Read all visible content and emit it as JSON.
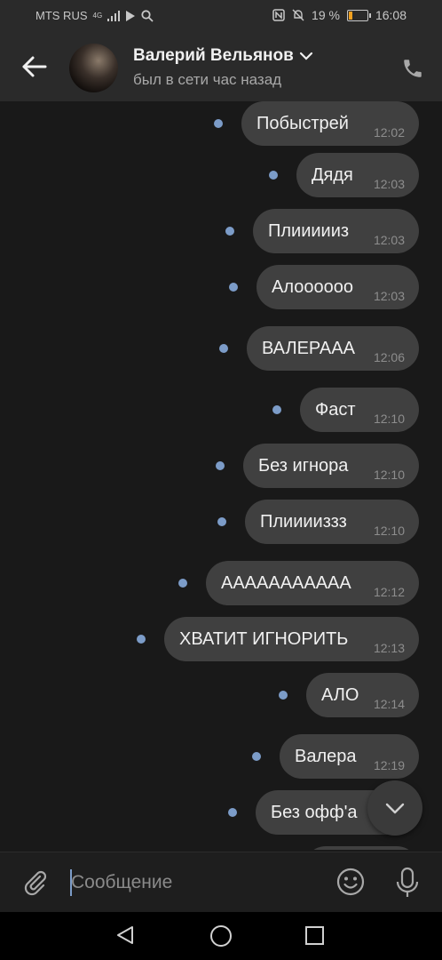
{
  "status_bar": {
    "carrier": "MTS RUS",
    "network": "4G",
    "battery": "19 %",
    "battery_level": 0.19,
    "time": "16:08"
  },
  "header": {
    "contact_name": "Валерий Вельянов",
    "contact_status": "был в сети час назад",
    "icons": [
      "back-arrow-icon",
      "chevron-down-icon",
      "phone-icon"
    ]
  },
  "messages": [
    {
      "text": "Побыстрей",
      "time": "12:02"
    },
    {
      "text": "Дядя",
      "time": "12:03"
    },
    {
      "text": "Плиииииз",
      "time": "12:03"
    },
    {
      "text": "Алоооооо",
      "time": "12:03"
    },
    {
      "text": "ВАЛЕРААА",
      "time": "12:06"
    },
    {
      "text": "Фаст",
      "time": "12:10"
    },
    {
      "text": "Без игнора",
      "time": "12:10"
    },
    {
      "text": "Плииииззз",
      "time": "12:10"
    },
    {
      "text": "ААААААААААА",
      "time": "12:12"
    },
    {
      "text": "ХВАТИТ ИГНОРИТЬ",
      "time": "12:13"
    },
    {
      "text": "АЛО",
      "time": "12:14"
    },
    {
      "text": "Валера",
      "time": "12:19"
    },
    {
      "text": "Без офф'а",
      "time": ""
    }
  ],
  "composer": {
    "placeholder": "Сообщение",
    "icons": [
      "paperclip-icon",
      "emoji-icon",
      "microphone-icon"
    ]
  },
  "colors": {
    "background": "#191919",
    "bubble": "#404040",
    "unread_dot": "#7c9cc8",
    "header": "#2a2a2a"
  }
}
